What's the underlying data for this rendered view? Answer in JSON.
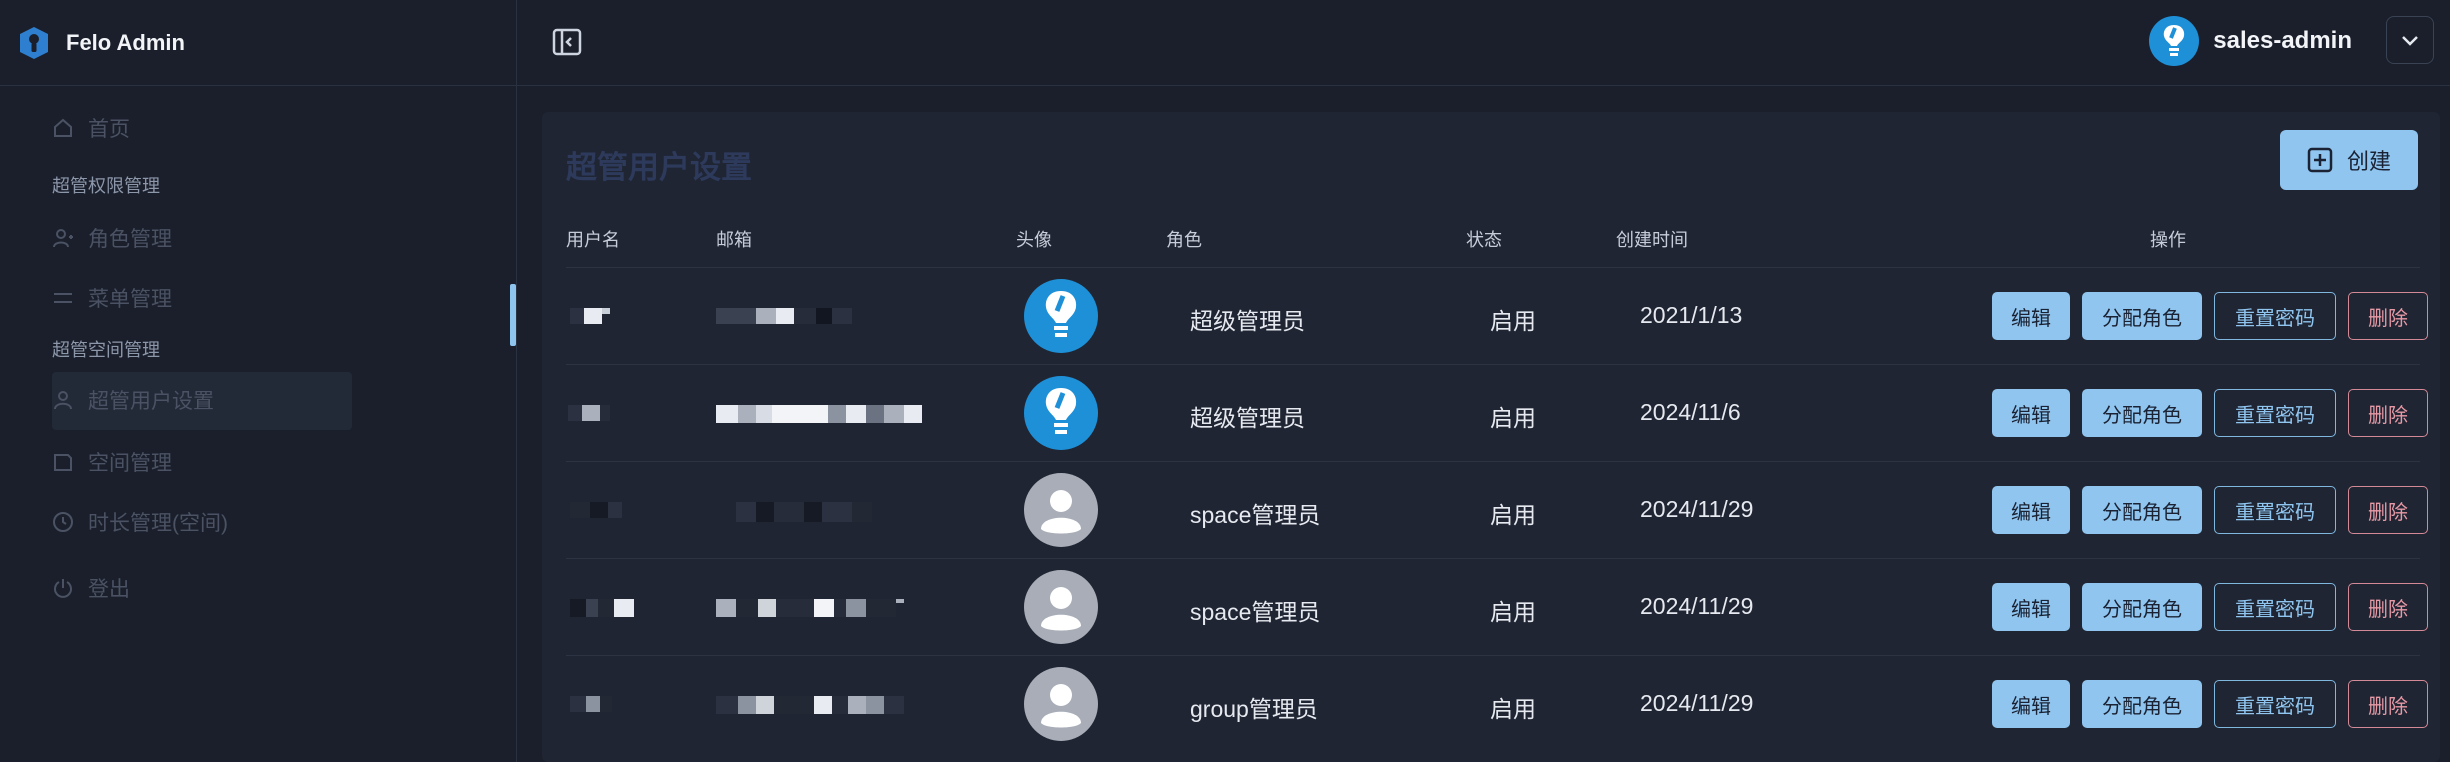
{
  "app": {
    "title": "Felo Admin"
  },
  "sidebar": {
    "items": [
      {
        "label": "首页",
        "icon": "home-icon"
      },
      {
        "label": "角色管理",
        "icon": "user-add-icon"
      },
      {
        "label": "菜单管理",
        "icon": "menu-icon"
      },
      {
        "label": "超管用户设置",
        "icon": "user-icon"
      },
      {
        "label": "空间管理",
        "icon": "folder-icon"
      },
      {
        "label": "时长管理(空间)",
        "icon": "clock-icon"
      },
      {
        "label": "登出",
        "icon": "power-icon"
      }
    ],
    "groups": [
      "超管权限管理",
      "超管空间管理"
    ]
  },
  "header": {
    "username": "sales-admin"
  },
  "page": {
    "title": "超管用户设置",
    "create_label": "创建",
    "columns": [
      "用户名",
      "邮箱",
      "头像",
      "角色",
      "状态",
      "创建时间",
      "操作"
    ],
    "actions": {
      "edit": "编辑",
      "assign": "分配角色",
      "reset": "重置密码",
      "delete": "删除"
    },
    "rows": [
      {
        "role": "超级管理员",
        "status": "启用",
        "created": "2021/1/13",
        "avatar": "bulb"
      },
      {
        "role": "超级管理员",
        "status": "启用",
        "created": "2024/11/6",
        "avatar": "bulb"
      },
      {
        "role": "space管理员",
        "status": "启用",
        "created": "2024/11/29",
        "avatar": "default"
      },
      {
        "role": "space管理员",
        "status": "启用",
        "created": "2024/11/29",
        "avatar": "default"
      },
      {
        "role": "group管理员",
        "status": "启用",
        "created": "2024/11/29",
        "avatar": "default"
      }
    ]
  },
  "colors": {
    "accent": "#8fc5ef",
    "danger": "#e79aa6",
    "background": "#1a1f2b",
    "panel": "#1f2533"
  }
}
